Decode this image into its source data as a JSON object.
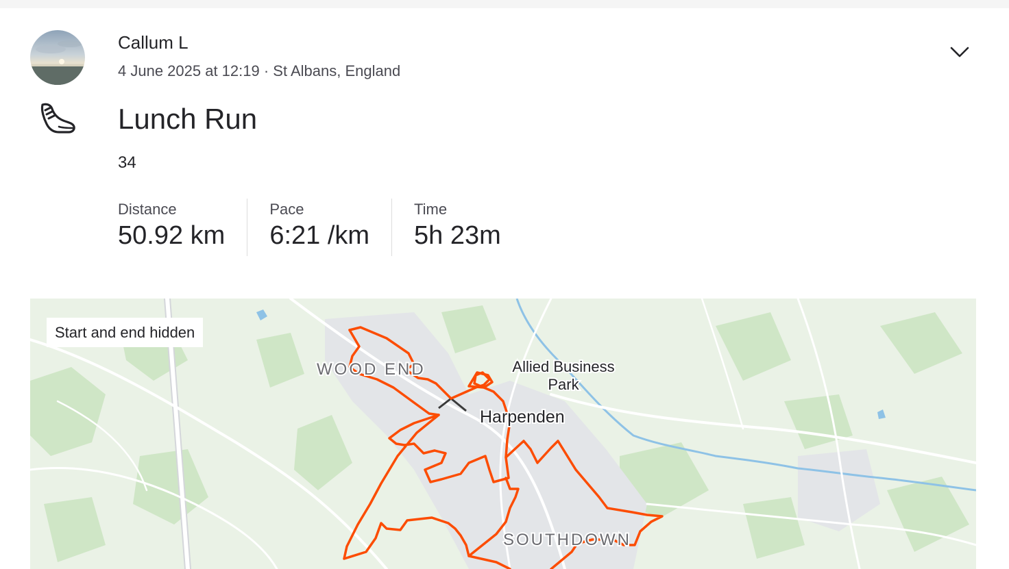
{
  "athlete": {
    "name": "Callum L",
    "meta": "4 June 2025 at 12:19 · St Albans, England"
  },
  "activity": {
    "sport_icon": "running-shoe-icon",
    "title": "Lunch Run",
    "description": "34",
    "stats": [
      {
        "label": "Distance",
        "value": "50.92 km"
      },
      {
        "label": "Pace",
        "value": "6:21 /km"
      },
      {
        "label": "Time",
        "value": "5h 23m"
      }
    ]
  },
  "header": {
    "menu_icon": "chevron-down-icon"
  },
  "map": {
    "privacy_badge": "Start and end hidden",
    "labels": {
      "wood_end": "WOOD END",
      "allied_line1": "Allied Business",
      "allied_line2": "Park",
      "harpenden": "Harpenden",
      "southdown": "SOUTHDOWN"
    },
    "route_color": "#fc4c02",
    "hidden_segment_color": "#3a3a3a"
  }
}
